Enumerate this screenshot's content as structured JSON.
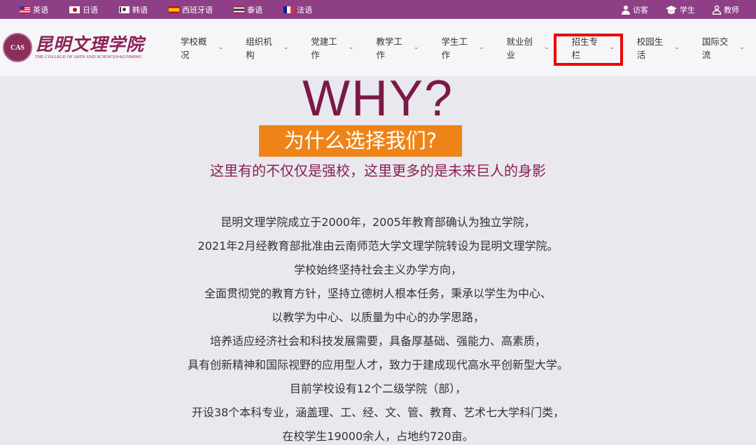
{
  "topbar": {
    "languages": [
      {
        "label": "英语",
        "flag": "us-flag-icon"
      },
      {
        "label": "日语",
        "flag": "japan-flag-icon"
      },
      {
        "label": "韩语",
        "flag": "korea-flag-icon"
      },
      {
        "label": "西班牙语",
        "flag": "spain-flag-icon"
      },
      {
        "label": "泰语",
        "flag": "thailand-flag-icon"
      },
      {
        "label": "法语",
        "flag": "france-flag-icon"
      }
    ],
    "user_links": [
      {
        "label": "访客",
        "icon": "person-icon"
      },
      {
        "label": "学生",
        "icon": "graduation-cap-icon"
      },
      {
        "label": "教师",
        "icon": "person-outline-icon"
      }
    ],
    "color": "#8e3f85"
  },
  "logo": {
    "seal_text": "CAS",
    "name_cn": "昆明文理学院",
    "name_en": "THE COLLEGE OF ARTS AND SCIENCES•KUNMING"
  },
  "nav": {
    "items": [
      {
        "label": "学校概况"
      },
      {
        "label": "组织机构"
      },
      {
        "label": "党建工作"
      },
      {
        "label": "教学工作"
      },
      {
        "label": "学生工作"
      },
      {
        "label": "就业创业"
      },
      {
        "label": "招生专栏",
        "highlighted": true
      },
      {
        "label": "校园生活"
      },
      {
        "label": "国际交流"
      }
    ],
    "chevron": "⌄"
  },
  "hero": {
    "heading": "WHY?",
    "banner": "为什么选择我们?",
    "tagline": "这里有的不仅仅是强校，这里更多的是未来巨人的身影",
    "paragraph_lines": [
      "昆明文理学院成立于2000年，2005年教育部确认为独立学院，",
      "2021年2月经教育部批准由云南师范大学文理学院转设为昆明文理学院。",
      "学校始终坚持社会主义办学方向，",
      "全面贯彻党的教育方针，坚持立德树人根本任务，秉承以学生为中心、",
      "以教学为中心、以质量为中心的办学思路，",
      "培养适应经济社会和科技发展需要，具备厚基础、强能力、高素质，",
      "具有创新精神和国际视野的应用型人才，致力于建成现代高水平创新型大学。",
      "目前学校设有12个二级学院（部），",
      "开设38个本科专业，涵盖理、工、经、文、管、教育、艺术七大学科门类，",
      "在校学生19000余人，占地约720亩。"
    ],
    "heading_color": "#7b1945",
    "banner_color": "#ee8418"
  },
  "highlight_color": "#ee0000"
}
